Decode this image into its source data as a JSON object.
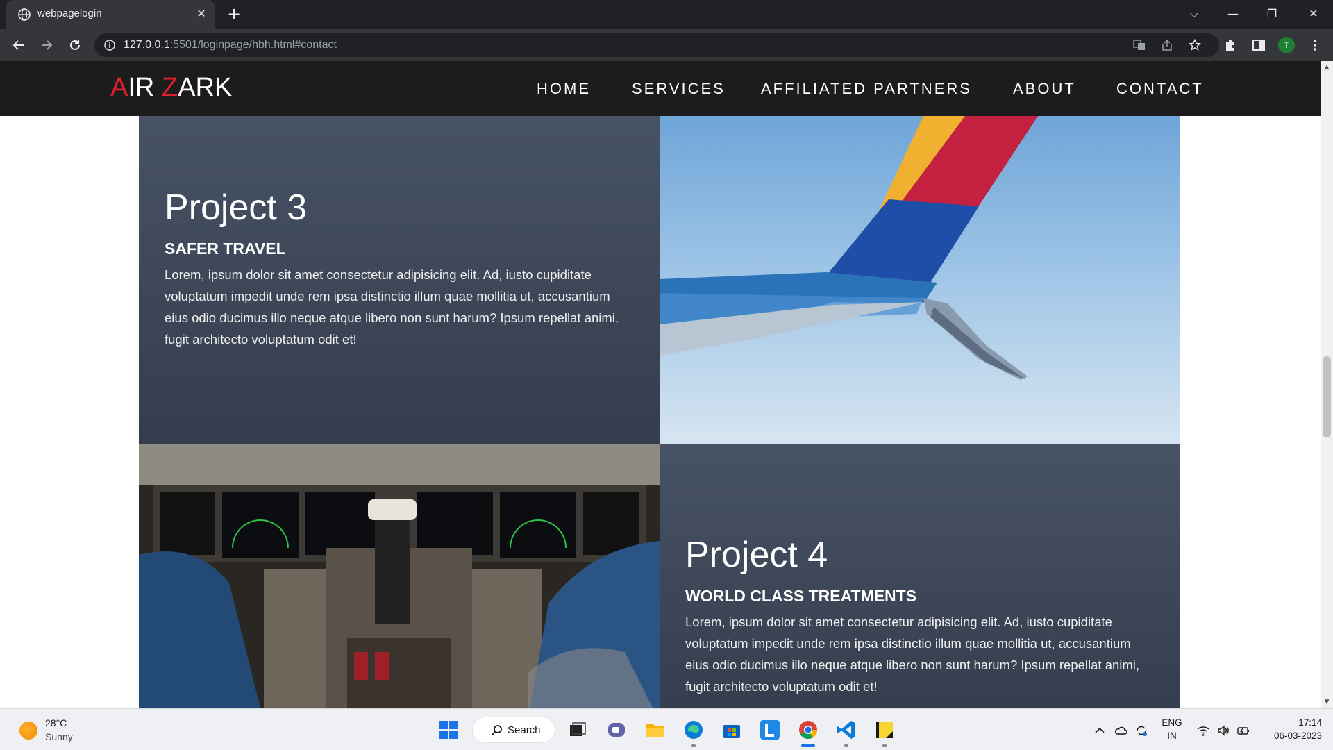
{
  "browser": {
    "tab_title": "webpagelogin",
    "url_host": "127.0.0.1",
    "url_rest": ":5501/loginpage/hbh.html#contact",
    "profile_initial": "T"
  },
  "site": {
    "logo_first_letter": "A",
    "logo_mid": "IR ",
    "logo_z": "Z",
    "logo_rest": "ARK",
    "nav": [
      "HOME",
      "SERVICES",
      "AFFILIATED PARTNERS",
      "ABOUT",
      "CONTACT"
    ]
  },
  "projects": [
    {
      "title": "Project 3",
      "subtitle": "SAFER TRAVEL",
      "text": "Lorem, ipsum dolor sit amet consectetur adipisicing elit. Ad, iusto cupiditate voluptatum impedit unde rem ipsa distinctio illum quae mollitia ut, accusantium eius odio ducimus illo neque atque libero non sunt harum? Ipsum repellat animi, fugit architecto voluptatum odit et!"
    },
    {
      "title": "Project 4",
      "subtitle": "WORLD CLASS TREATMENTS",
      "text": "Lorem, ipsum dolor sit amet consectetur adipisicing elit. Ad, iusto cupiditate voluptatum impedit unde rem ipsa distinctio illum quae mollitia ut, accusantium eius odio ducimus illo neque atque libero non sunt harum? Ipsum repellat animi, fugit architecto voluptatum odit et!"
    }
  ],
  "taskbar": {
    "temperature": "28°C",
    "condition": "Sunny",
    "search_label": "Search",
    "language": "ENG",
    "region": "IN",
    "time": "17:14",
    "date": "06-03-2023"
  },
  "colors": {
    "accent_red": "#e0202e",
    "navbar_bg": "#1c1c1c",
    "card_bg": "#3d4657"
  }
}
